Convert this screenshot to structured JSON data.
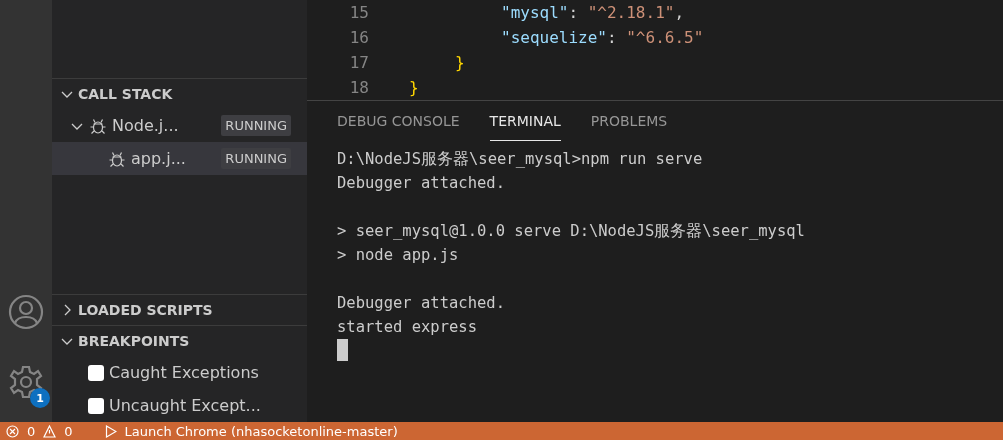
{
  "editor": {
    "lines": [
      {
        "number": "15",
        "tokens": [
          {
            "kind": "key",
            "text": "\"mysql\""
          },
          {
            "kind": "punct",
            "text": ": "
          },
          {
            "kind": "string",
            "text": "\"^2.18.1\""
          },
          {
            "kind": "punct",
            "text": ","
          }
        ],
        "kind": "property"
      },
      {
        "number": "16",
        "tokens": [
          {
            "kind": "key",
            "text": "\"sequelize\""
          },
          {
            "kind": "punct",
            "text": ": "
          },
          {
            "kind": "string",
            "text": "\"^6.6.5\""
          }
        ],
        "kind": "property"
      },
      {
        "number": "17",
        "tokens": [
          {
            "kind": "bracket",
            "text": "}"
          }
        ],
        "kind": "inner_close"
      },
      {
        "number": "18",
        "tokens": [
          {
            "kind": "bracket",
            "text": "}"
          }
        ],
        "kind": "outer_close"
      }
    ]
  },
  "activity_bar": {
    "settings_badge": "1"
  },
  "sidebar": {
    "sections": [
      {
        "title": "CALL STACK",
        "expanded": true,
        "kind": "callstack",
        "items": [
          {
            "label": "Node.j...",
            "status": "RUNNING",
            "selected": false,
            "expanded": true,
            "children": [
              {
                "label": "app.j...",
                "status": "RUNNING",
                "selected": true
              }
            ]
          }
        ]
      },
      {
        "title": "LOADED SCRIPTS",
        "expanded": false,
        "kind": "scripts"
      },
      {
        "title": "BREAKPOINTS",
        "expanded": true,
        "kind": "breakpoints",
        "items": [
          {
            "label": "Caught Exceptions",
            "checked": false
          },
          {
            "label": "Uncaught Except...",
            "checked": false
          }
        ]
      }
    ]
  },
  "panel": {
    "tabs": [
      {
        "label": "DEBUG CONSOLE",
        "selected": false
      },
      {
        "label": "TERMINAL",
        "selected": true
      },
      {
        "label": "PROBLEMS",
        "selected": false
      }
    ],
    "terminal_blocks": [
      [
        "D:\\NodeJS服务器\\seer_mysql>npm run serve",
        "Debugger attached."
      ],
      [
        "> seer_mysql@1.0.0 serve D:\\NodeJS服务器\\seer_mysql",
        "> node app.js"
      ],
      [
        "Debugger attached.",
        "started express"
      ]
    ]
  },
  "status_bar": {
    "errors": "0",
    "warnings": "0",
    "launch": "Launch Chrome (nhasocketonline-master)"
  }
}
